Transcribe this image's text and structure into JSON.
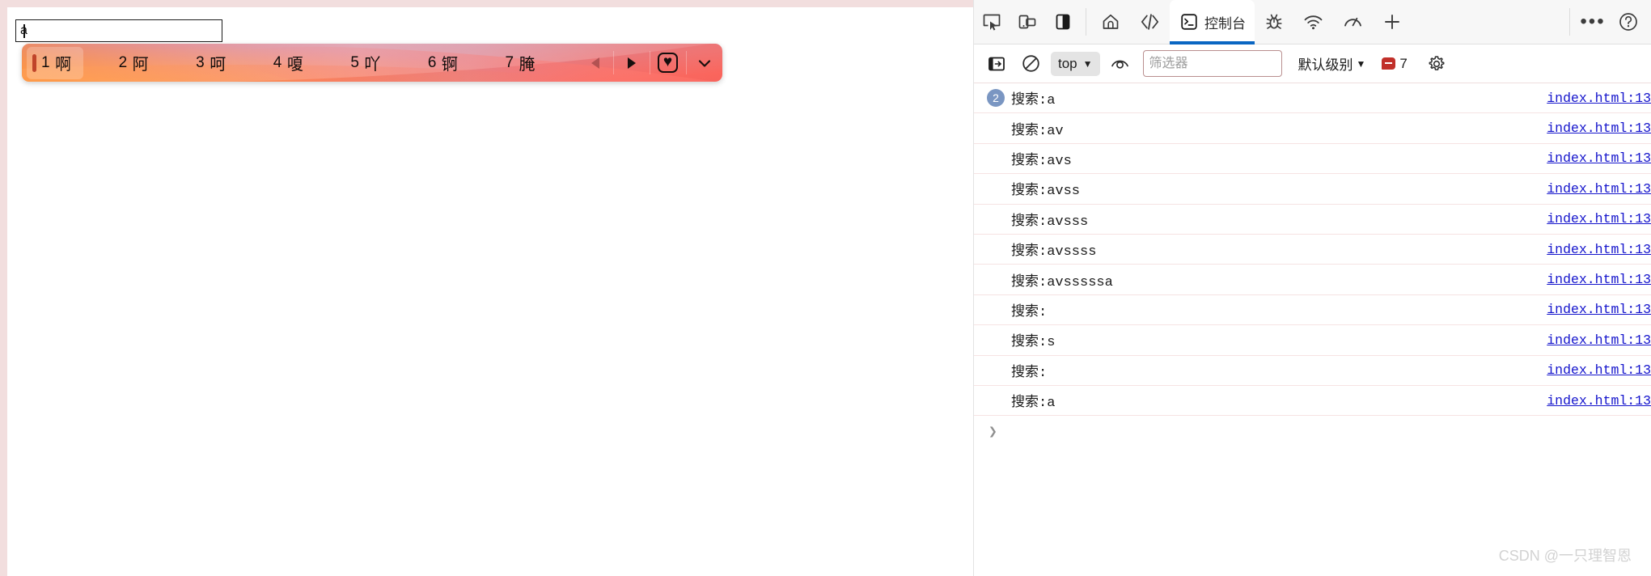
{
  "page": {
    "search_field": {
      "value": "a",
      "placeholder": ""
    }
  },
  "ime": {
    "candidates": [
      {
        "index": "1",
        "word": "啊",
        "selected": true
      },
      {
        "index": "2",
        "word": "阿",
        "selected": false
      },
      {
        "index": "3",
        "word": "呵",
        "selected": false
      },
      {
        "index": "4",
        "word": "嗄",
        "selected": false
      },
      {
        "index": "5",
        "word": "吖",
        "selected": false
      },
      {
        "index": "6",
        "word": "锕",
        "selected": false
      },
      {
        "index": "7",
        "word": "腌",
        "selected": false
      }
    ],
    "controls": {
      "prev_page_icon": "triangle-left-icon",
      "next_page_icon": "triangle-right-icon",
      "favorite_icon": "heart-box-icon",
      "favorite_glyph": "♥",
      "expand_icon": "chevron-down-icon"
    },
    "accent_colors": {
      "selection_bar": "#c0442a",
      "gradient_start": "#f9833f",
      "gradient_end": "#f45f5a"
    }
  },
  "devtools": {
    "toolbar": {
      "left_buttons": [
        {
          "name": "inspect-element-icon",
          "label": ""
        },
        {
          "name": "device-toolbar-icon",
          "label": ""
        },
        {
          "name": "dock-side-icon",
          "label": ""
        }
      ],
      "tabs": [
        {
          "name": "tab-welcome",
          "icon": "home-icon",
          "label": "",
          "active": false
        },
        {
          "name": "tab-elements",
          "icon": "code-icon",
          "label": "",
          "active": false
        },
        {
          "name": "tab-console",
          "icon": "console-icon",
          "label": "控制台",
          "active": true
        },
        {
          "name": "tab-sources",
          "icon": "bug-icon",
          "label": "",
          "active": false
        },
        {
          "name": "tab-network",
          "icon": "wifi-icon",
          "label": "",
          "active": false
        },
        {
          "name": "tab-performance",
          "icon": "gauge-icon",
          "label": "",
          "active": false
        },
        {
          "name": "tab-add",
          "icon": "plus-icon",
          "label": "",
          "active": false
        }
      ],
      "more_tools_icon": "ellipsis-icon",
      "help_icon": "help-circle-icon",
      "active_tab_underline_color": "#0a66c2"
    },
    "console_toolbar": {
      "sidebar_toggle_icon": "show-console-sidebar-icon",
      "clear_console_icon": "clear-console-icon",
      "context_selector": {
        "value": "top",
        "chevron": "▼"
      },
      "live_expression_icon": "eye-icon",
      "filter_input": {
        "value": "",
        "placeholder": "筛选器"
      },
      "level_selector": {
        "label": "默认级别",
        "chevron": "▼"
      },
      "issues": {
        "count": "7",
        "badge_color": "#c1302a"
      },
      "settings_icon": "gear-icon"
    },
    "console_log": {
      "source_label": "index.html:13",
      "entries": [
        {
          "badge": "2",
          "message": "搜索:a",
          "source": "index.html:13"
        },
        {
          "badge": "",
          "message": "搜索:av",
          "source": "index.html:13"
        },
        {
          "badge": "",
          "message": "搜索:avs",
          "source": "index.html:13"
        },
        {
          "badge": "",
          "message": "搜索:avss",
          "source": "index.html:13"
        },
        {
          "badge": "",
          "message": "搜索:avsss",
          "source": "index.html:13"
        },
        {
          "badge": "",
          "message": "搜索:avssss",
          "source": "index.html:13"
        },
        {
          "badge": "",
          "message": "搜索:avsssssa",
          "source": "index.html:13"
        },
        {
          "badge": "",
          "message": "搜索:",
          "source": "index.html:13"
        },
        {
          "badge": "",
          "message": "搜索:s",
          "source": "index.html:13"
        },
        {
          "badge": "",
          "message": "搜索:",
          "source": "index.html:13"
        },
        {
          "badge": "",
          "message": "搜索:a",
          "source": "index.html:13"
        }
      ],
      "prompt_chevron": "❯"
    }
  },
  "watermark": {
    "text": "CSDN @一只理智恩"
  }
}
